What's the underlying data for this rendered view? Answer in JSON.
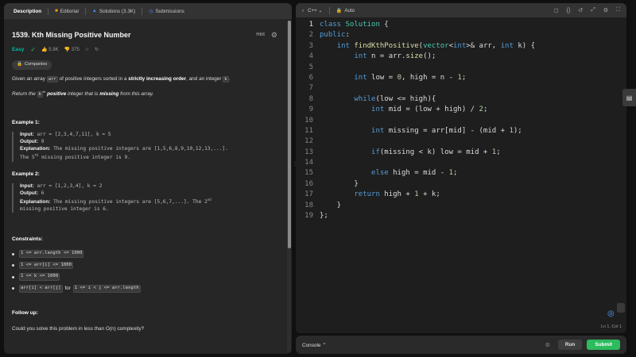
{
  "tabs": {
    "description": "Description",
    "editorial": "Editorial",
    "solutions": "Solutions (3.3K)",
    "submissions": "Submissions"
  },
  "problem": {
    "title": "1539. Kth Missing Positive Number",
    "hint": "Hint",
    "difficulty": "Easy",
    "likes": "5.9K",
    "dislikes": "375",
    "companies": "Companies",
    "desc_p1_a": "Given an array ",
    "desc_p1_code1": "arr",
    "desc_p1_b": " of positive integers sorted in a ",
    "desc_p1_bold": "strictly increasing order",
    "desc_p1_c": ", and an integer ",
    "desc_p1_code2": "k",
    "desc_p1_d": ".",
    "desc_p2_a": "Return the ",
    "desc_p2_code": "k",
    "desc_p2_sup": "th",
    "desc_p2_bold1": "positive",
    "desc_p2_b": " integer that is ",
    "desc_p2_bold2": "missing",
    "desc_p2_c": " from this array."
  },
  "examples": [
    {
      "heading": "Example 1:",
      "input_label": "Input:",
      "input": " arr = [2,3,4,7,11], k = 5",
      "output_label": "Output:",
      "output": " 9",
      "expl_label": "Explanation:",
      "expl_a": " The missing positive integers are [1,5,6,8,9,10,12,13,...].",
      "expl_b": "The 5",
      "expl_sup": "th",
      "expl_c": " missing positive integer is 9."
    },
    {
      "heading": "Example 2:",
      "input_label": "Input:",
      "input": " arr = [1,2,3,4], k = 2",
      "output_label": "Output:",
      "output": " 6",
      "expl_label": "Explanation:",
      "expl_a": " The missing positive integers are [5,6,7,...]. The 2",
      "expl_sup": "nd",
      "expl_b": "missing positive integer is 6."
    }
  ],
  "constraints": {
    "heading": "Constraints:",
    "c1": "1 <= arr.length <= 1000",
    "c2": "1 <= arr[i] <= 1000",
    "c3": "1 <= k <= 1000",
    "c4a": "arr[i] < arr[j]",
    "c4b": "for",
    "c4c": "1 <= i < j <= arr.length"
  },
  "followup": {
    "heading": "Follow up:",
    "text": "Could you solve this problem in less than O(n) complexity?"
  },
  "editor": {
    "language": "C++",
    "autosave": "Auto",
    "cursor": "Ln 1, Col 1",
    "lines": [
      "class Solution {",
      "public:",
      "    int findKthPositive(vector<int>& arr, int k) {",
      "        int n = arr.size();",
      "",
      "        int low = 0, high = n - 1;",
      "",
      "        while(low <= high){",
      "            int mid = (low + high) / 2;",
      "",
      "            int missing = arr[mid] - (mid + 1);",
      "",
      "            if(missing < k) low = mid + 1;",
      "",
      "            else high = mid - 1;",
      "        }",
      "        return high + 1 + k;",
      "    }",
      "};"
    ]
  },
  "console": {
    "label": "Console",
    "run": "Run",
    "submit": "Submit"
  },
  "colors": {
    "keyword": "#569cd6",
    "type_name": "#4ec9b0",
    "function": "#dcdcaa",
    "number": "#b5cea8",
    "submit": "#2cbb5d",
    "easy": "#00b8a3"
  }
}
